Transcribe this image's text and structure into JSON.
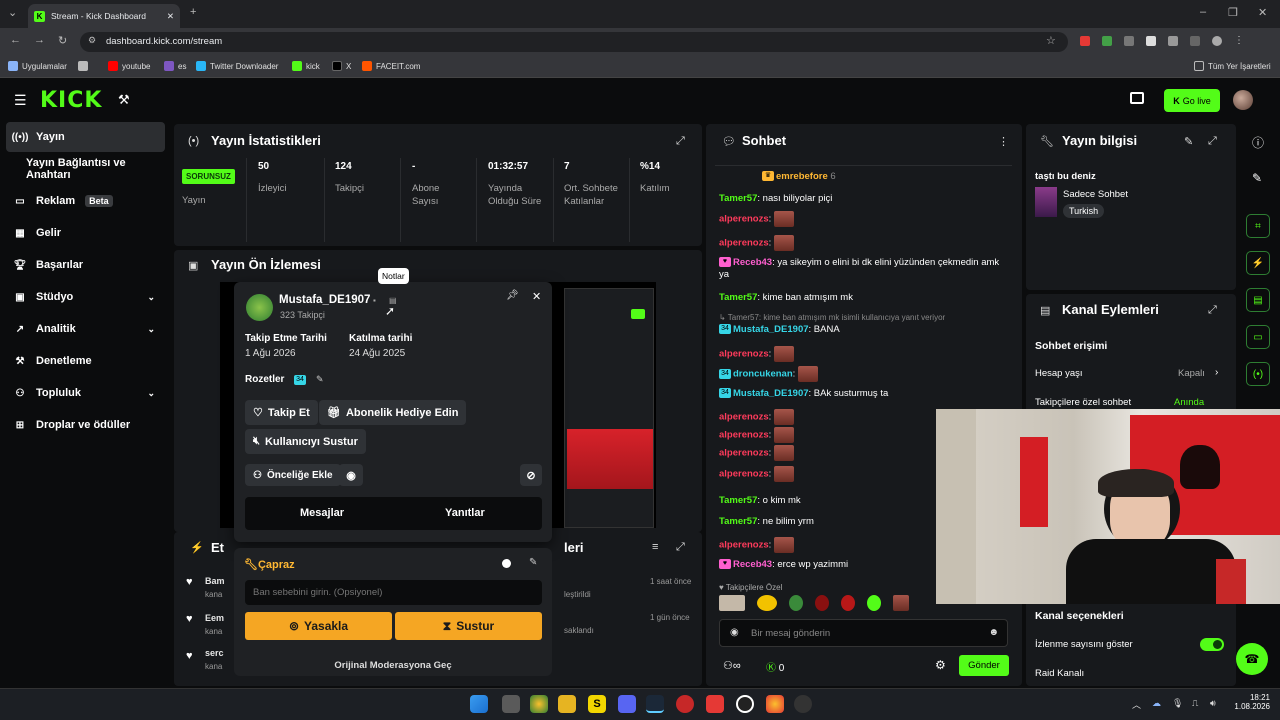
{
  "browser": {
    "tab_title": "Stream - Kick Dashboard",
    "url": "dashboard.kick.com/stream",
    "bookmarks": [
      "Uygulamalar",
      "youtube",
      "es",
      "Twitter Downloader",
      "kick",
      "X",
      "FACEIT.com"
    ],
    "all_bookmarks": "Tüm Yer İşaretleri"
  },
  "header": {
    "logo": "KICK",
    "go_live": "Go live"
  },
  "sidebar": {
    "items": [
      {
        "label": "Yayın"
      },
      {
        "label": "Yayın Bağlantısı ve Anahtarı"
      },
      {
        "label": "Reklam",
        "badge": "Beta"
      },
      {
        "label": "Gelir"
      },
      {
        "label": "Başarılar"
      },
      {
        "label": "Stüdyo"
      },
      {
        "label": "Analitik"
      },
      {
        "label": "Denetleme"
      },
      {
        "label": "Topluluk"
      },
      {
        "label": "Droplar ve ödüller"
      }
    ]
  },
  "stats": {
    "title": "Yayın İstatistikleri",
    "status": "SORUNSUZ",
    "status_label": "Yayın",
    "items": [
      {
        "value": "50",
        "label": "İzleyici"
      },
      {
        "value": "124",
        "label": "Takipçi"
      },
      {
        "value": "-",
        "label": "Abone Sayısı"
      },
      {
        "value": "01:32:57",
        "label": "Yayında Olduğu Süre"
      },
      {
        "value": "7",
        "label": "Ort. Sohbete Katılanlar"
      },
      {
        "value": "%14",
        "label": "Katılım"
      }
    ]
  },
  "preview": {
    "title": "Yayın Ön İzlemesi"
  },
  "activity": {
    "title": "Et",
    "rows": [
      {
        "name": "Bam",
        "sub": "kana",
        "time": "1 saat önce",
        "note": "leştirildi"
      },
      {
        "name": "Eem",
        "sub": "kana",
        "time": "1 gün önce",
        "note": "saklandı"
      },
      {
        "name": "serc",
        "sub": "kana"
      }
    ],
    "panel2_title": "leri"
  },
  "user_card": {
    "tooltip": "Notlar",
    "username": "Mustafa_DE1907",
    "followers": "323 Takipçi",
    "follow_date_label": "Takip Etme Tarihi",
    "follow_date": "1 Ağu 2026",
    "join_date_label": "Katılma tarihi",
    "join_date": "24 Ağu 2025",
    "badges_label": "Rozetler",
    "badge_num": "34",
    "follow_btn": "Takip Et",
    "gift_btn": "Abonelik Hediye Edin",
    "mute_btn": "Kullanıcıyı Sustur",
    "priority_btn": "Önceliğe Ekle",
    "tab_messages": "Mesajlar",
    "tab_replies": "Yanıtlar"
  },
  "mod_card": {
    "title": "Çapraz",
    "ban_placeholder": "Ban sebebini girin. (Opsiyonel)",
    "ban_btn": "Yasakla",
    "mute_btn": "Sustur",
    "switch_link": "Orijinal Moderasyona Geç"
  },
  "chat": {
    "title": "Sohbet",
    "pinned_user": "emrebefore",
    "pinned_count": "6",
    "messages": [
      {
        "user": "Tamer57",
        "cls": "ug",
        "text": "nası biliyolar piçi"
      },
      {
        "user": "alperenozs",
        "cls": "ur",
        "emote": true
      },
      {
        "user": "alperenozs",
        "cls": "ur",
        "emote": true
      },
      {
        "user": "Receb43",
        "cls": "up",
        "text": "ya sikeyim o elini bi dk elini yüzünden çekmedin amk ya"
      },
      {
        "user": "Tamer57",
        "cls": "ug",
        "text": "kime ban atmışım mk"
      },
      {
        "reply": "Tamer57: kime ban atmışım mk isimli kullanıcıya yanıt veriyor"
      },
      {
        "user": "Mustafa_DE1907",
        "cls": "uc",
        "text": "BANA"
      },
      {
        "user": "alperenozs",
        "cls": "ur",
        "emote": true
      },
      {
        "user": "droncukenan",
        "cls": "uc",
        "emote": true
      },
      {
        "user": "Mustafa_DE1907",
        "cls": "uc",
        "text": "BAk susturmuş ta"
      },
      {
        "user": "alperenozs",
        "cls": "ur",
        "emote": true
      },
      {
        "user": "alperenozs",
        "cls": "ur",
        "emote": true
      },
      {
        "user": "alperenozs",
        "cls": "ur",
        "emote": true
      },
      {
        "user": "alperenozs",
        "cls": "ur",
        "emote": true
      },
      {
        "user": "Tamer57",
        "cls": "ug",
        "text": "o kim mk"
      },
      {
        "user": "Tamer57",
        "cls": "ug",
        "text": "ne bilim yrm"
      },
      {
        "user": "alperenozs",
        "cls": "ur",
        "emote": true
      },
      {
        "user": "Receb43",
        "cls": "up",
        "text": "erce wp yazimmi"
      }
    ],
    "followers_only": "Takipçilere Özel",
    "input_placeholder": "Bir mesaj gönderin",
    "points": "0",
    "send": "Gönder"
  },
  "stream_info": {
    "title": "Yayın bilgisi",
    "stream_title": "taştı bu deniz",
    "category": "Sadece Sohbet",
    "tag": "Turkish"
  },
  "channel_actions": {
    "title": "Kanal Eylemleri",
    "chat_access": "Sohbet erişimi",
    "account_age": "Hesap yaşı",
    "account_age_val": "Kapalı",
    "follower_chat": "Takipçilere özel sohbet",
    "follower_chat_val": "Anında",
    "channel_options": "Kanal seçenekleri",
    "show_viewers": "İzlenme sayısını göster",
    "raid": "Raid Kanalı"
  },
  "taskbar": {
    "time": "18:21",
    "date": "1.08.2026"
  }
}
